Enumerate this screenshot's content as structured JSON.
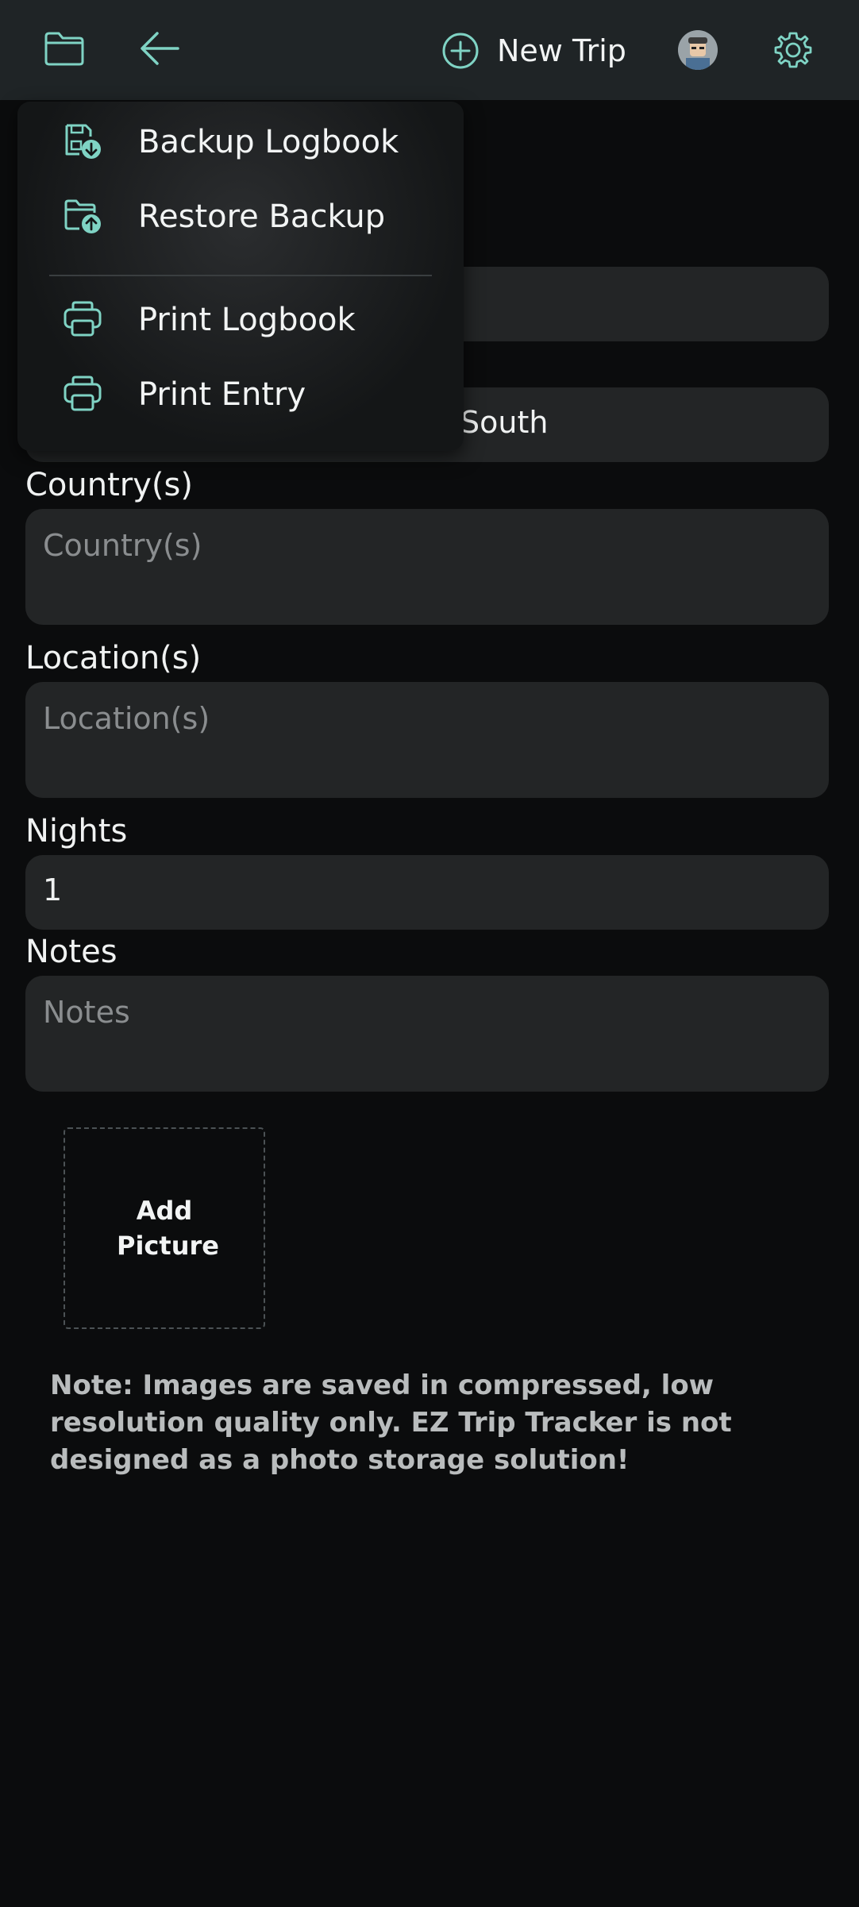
{
  "topbar": {
    "new_trip_label": "New Trip"
  },
  "menu": {
    "items": [
      {
        "label": "Backup Logbook",
        "icon": "save-download-icon"
      },
      {
        "label": "Restore Backup",
        "icon": "folder-upload-icon"
      },
      {
        "label": "Print Logbook",
        "icon": "printer-icon"
      },
      {
        "label": "Print Entry",
        "icon": "printer-icon"
      }
    ]
  },
  "form": {
    "hidden_field_1_value": "",
    "hidden_field_2_partial_value": "South",
    "country": {
      "label": "Country(s)",
      "placeholder": "Country(s)",
      "value": ""
    },
    "location": {
      "label": "Location(s)",
      "placeholder": "Location(s)",
      "value": ""
    },
    "nights": {
      "label": "Nights",
      "value": "1"
    },
    "notes": {
      "label": "Notes",
      "placeholder": "Notes",
      "value": ""
    }
  },
  "add_picture_label": "Add Picture",
  "note_text": "Note: Images are saved in compressed, low resolution quality only. EZ Trip Tracker is not designed as a photo storage solution!",
  "colors": {
    "accent": "#7fd3c4",
    "topbar_bg": "#1f2426",
    "field_bg": "#232526",
    "page_bg": "#0b0c0d"
  }
}
